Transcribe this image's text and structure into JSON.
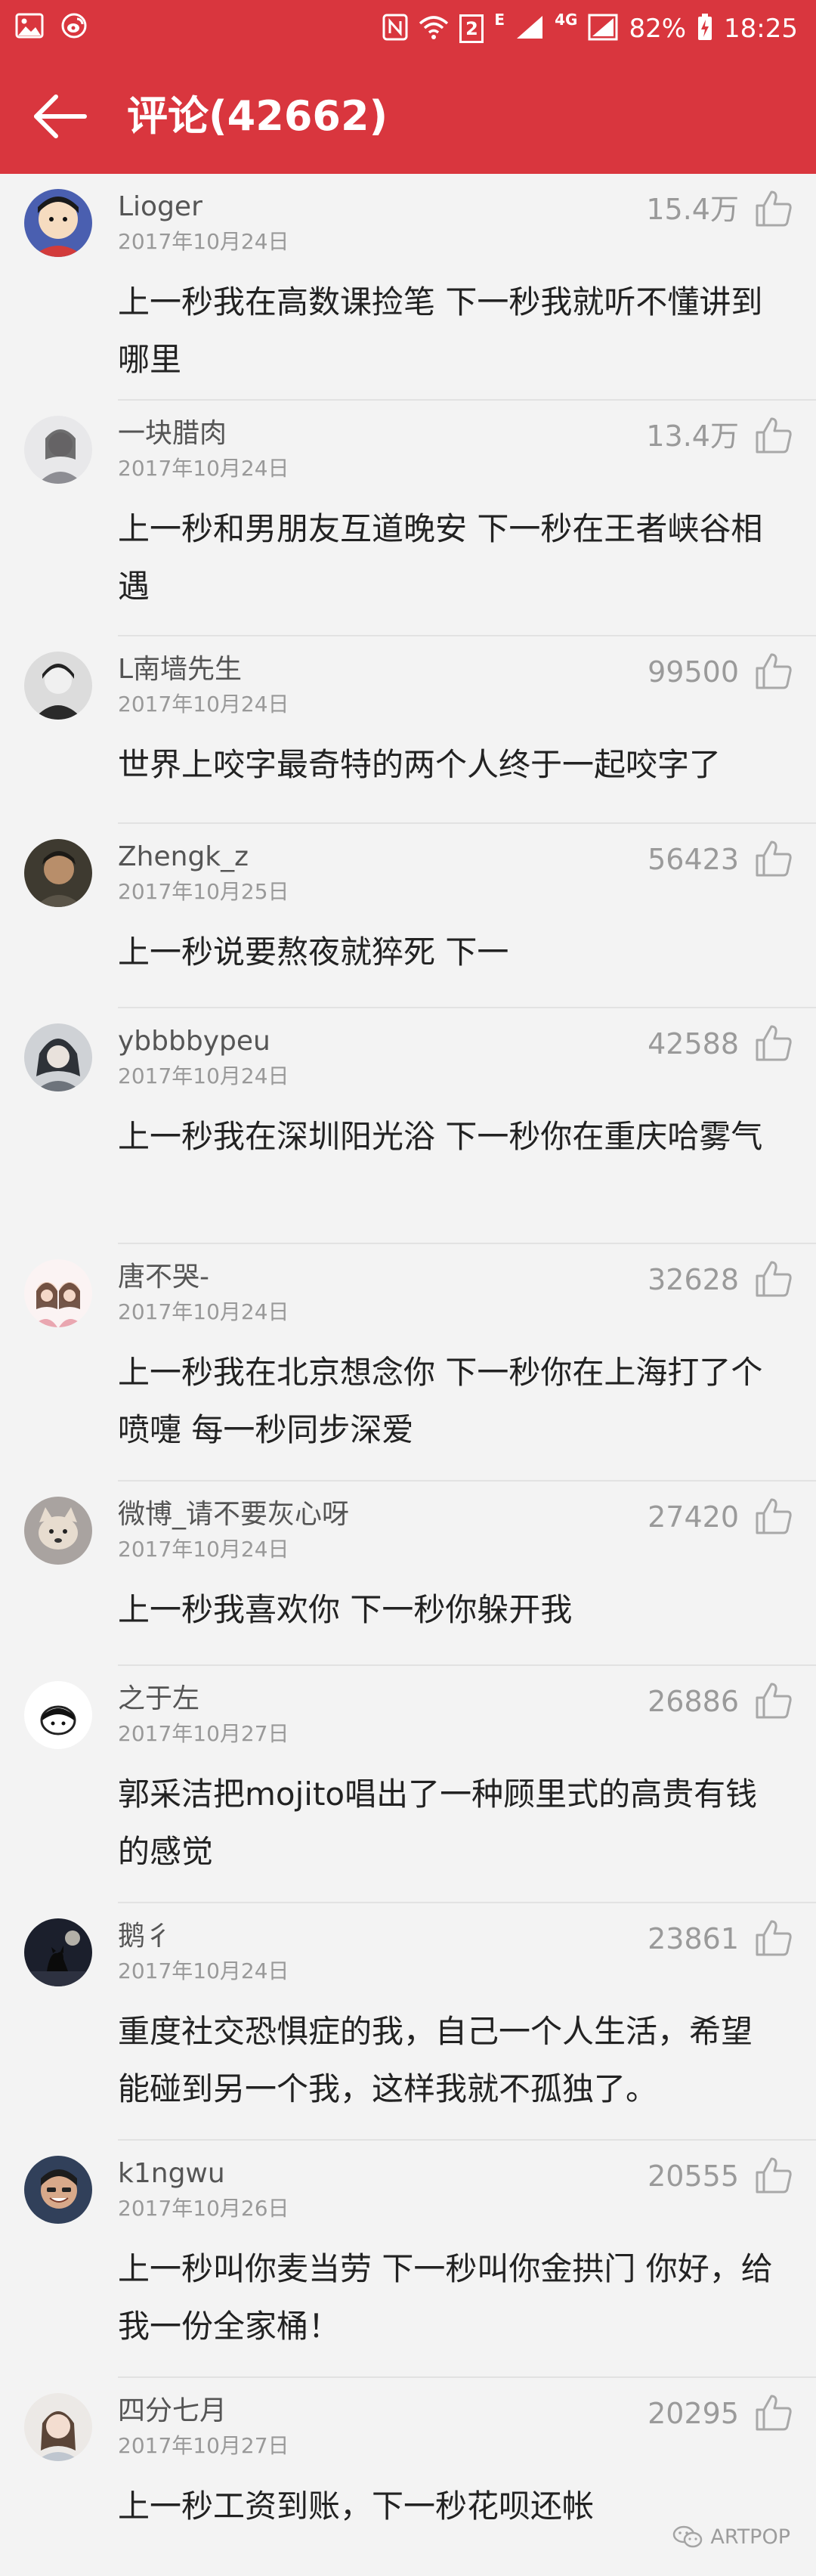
{
  "status_bar": {
    "network_type": "4G",
    "e_label": "E",
    "sim_number": "2",
    "battery": "82%",
    "time": "18:25"
  },
  "app_bar": {
    "title": "评论(42662)"
  },
  "comments": [
    {
      "user": "Lioger",
      "date": "2017年10月24日",
      "likes": "15.4万",
      "text": "上一秒我在高数课捡笔  下一秒我就听不懂讲到哪里"
    },
    {
      "user": "一块腊肉",
      "date": "2017年10月24日",
      "likes": "13.4万",
      "text": "上一秒和男朋友互道晚安 下一秒在王者峡谷相遇"
    },
    {
      "user": "L南墙先生",
      "date": "2017年10月24日",
      "likes": "99500",
      "text": "世界上咬字最奇特的两个人终于一起咬字了"
    },
    {
      "user": "Zhengk_z",
      "date": "2017年10月25日",
      "likes": "56423",
      "text": "上一秒说要熬夜就猝死 下一"
    },
    {
      "user": "ybbbbypeu",
      "date": "2017年10月24日",
      "likes": "42588",
      "text": "上一秒我在深圳阳光浴 下一秒你在重庆哈雾气"
    },
    {
      "user": "唐不哭-",
      "date": "2017年10月24日",
      "likes": "32628",
      "text": "上一秒我在北京想念你 下一秒你在上海打了个喷嚏 每一秒同步深爱"
    },
    {
      "user": "微博_请不要灰心呀",
      "date": "2017年10月24日",
      "likes": "27420",
      "text": "上一秒我喜欢你 下一秒你躲开我"
    },
    {
      "user": "之于左",
      "date": "2017年10月27日",
      "likes": "26886",
      "text": "郭采洁把mojito唱出了一种顾里式的高贵有钱的感觉"
    },
    {
      "user": "鹅彳",
      "date": "2017年10月24日",
      "likes": "23861",
      "text": "重度社交恐惧症的我，自己一个人生活，希望能碰到另一个我，这样我就不孤独了。"
    },
    {
      "user": "k1ngwu",
      "date": "2017年10月26日",
      "likes": "20555",
      "text": "上一秒叫你麦当劳 下一秒叫你金拱门 你好，给我一份全家桶！"
    },
    {
      "user": "四分七月",
      "date": "2017年10月27日",
      "likes": "20295",
      "text": "上一秒工资到账，下一秒花呗还帐"
    }
  ],
  "watermark": {
    "text": "ARTPOP"
  }
}
